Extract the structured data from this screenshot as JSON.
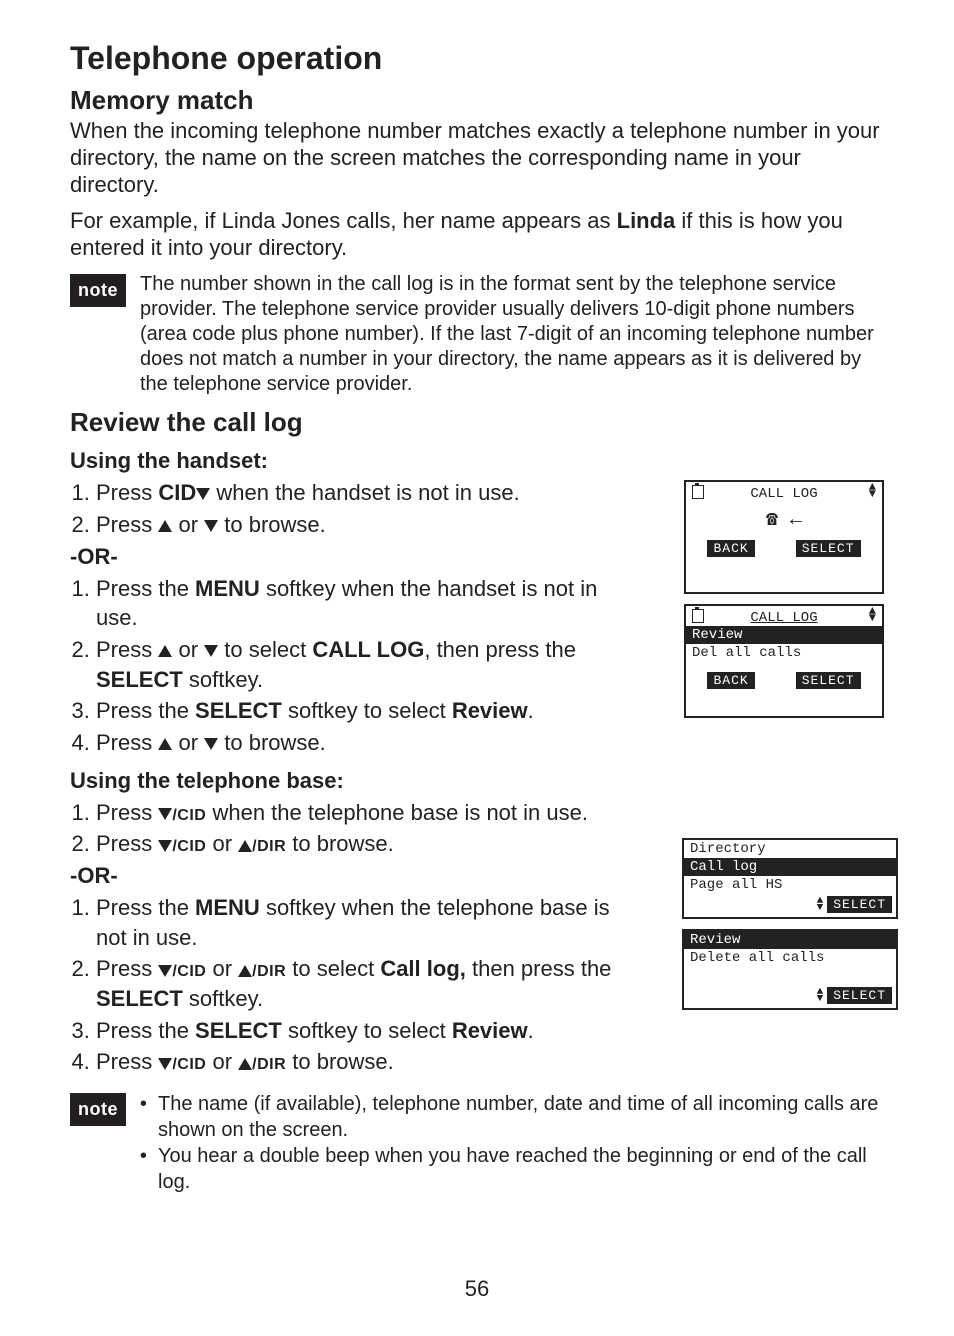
{
  "page_title": "Telephone operation",
  "section1": {
    "heading": "Memory match",
    "para1": "When the incoming telephone number matches exactly a telephone number in your directory, the name on the screen matches the corresponding name in your directory.",
    "para2_a": "For example, if Linda Jones calls, her name appears as ",
    "para2_b": "Linda",
    "para2_c": " if this is how you entered it into your directory."
  },
  "note1": {
    "label": "note",
    "text": "The number shown in the call log is in the format sent by the telephone service provider. The telephone service provider usually delivers 10-digit phone numbers (area code plus phone number). If the last 7-digit of an incoming telephone number does not match a number in your directory, the name appears as it is delivered by the telephone service provider."
  },
  "section2": {
    "heading": "Review the call log",
    "sub_handset": "Using the handset:",
    "hs1_a": "Press ",
    "hs1_b": "CID",
    "hs1_c": " when the handset is not in use.",
    "hs2_a": "Press ",
    "hs2_b": " or ",
    "hs2_c": " to browse.",
    "or": "-OR-",
    "hsb1_a": "Press the ",
    "hsb1_b": "MENU",
    "hsb1_c": " softkey when the handset is not in use.",
    "hsb2_a": "Press ",
    "hsb2_b": " or ",
    "hsb2_c": " to select ",
    "hsb2_d": "CALL LOG",
    "hsb2_e": ", then press the ",
    "hsb2_f": "SELECT",
    "hsb2_g": " softkey.",
    "hsb3_a": "Press the ",
    "hsb3_b": "SELECT",
    "hsb3_c": " softkey to select ",
    "hsb3_d": "Review",
    "hsb3_e": ".",
    "hsb4_a": "Press ",
    "hsb4_b": " or ",
    "hsb4_c": " to browse.",
    "sub_base": "Using the telephone base:",
    "tb1_a": "Press ",
    "tb1_b": "/CID",
    "tb1_c": " when the telephone base is not in use.",
    "tb2_a": "Press ",
    "tb2_b": "/CID",
    "tb2_c": " or ",
    "tb2_d": "/DIR",
    "tb2_e": " to browse.",
    "tbb1_a": "Press the ",
    "tbb1_b": "MENU",
    "tbb1_c": " softkey when the telephone base is not in use.",
    "tbb2_a": "Press ",
    "tbb2_b": "/CID",
    "tbb2_c": " or ",
    "tbb2_d": "/DIR",
    "tbb2_e": " to select ",
    "tbb2_f": "Call log,",
    "tbb2_g": " then press the ",
    "tbb2_h": "SELECT",
    "tbb2_i": " softkey.",
    "tbb3_a": "Press the ",
    "tbb3_b": "SELECT",
    "tbb3_c": " softkey to select ",
    "tbb3_d": "Review",
    "tbb3_e": ".",
    "tbb4_a": "Press ",
    "tbb4_b": "/CID",
    "tbb4_c": " or ",
    "tbb4_d": "/DIR",
    "tbb4_e": " to browse."
  },
  "note2": {
    "label": "note",
    "b1": "The name (if available), telephone number, date and time of all incoming calls are shown on the screen.",
    "b2": "You hear a double beep when you have reached the beginning or end of the call log."
  },
  "screens": {
    "h1": {
      "title": "CALL LOG",
      "back": "BACK",
      "select": "SELECT"
    },
    "h2": {
      "title": "CALL LOG",
      "row1": "Review",
      "row2": "Del all calls",
      "back": "BACK",
      "select": "SELECT"
    },
    "b1": {
      "row1": "Directory",
      "row2": "Call log",
      "row3": "Page all HS",
      "select": "SELECT"
    },
    "b2": {
      "row1": "Review",
      "row2": "Delete all calls",
      "select": "SELECT"
    }
  },
  "page_number": "56"
}
